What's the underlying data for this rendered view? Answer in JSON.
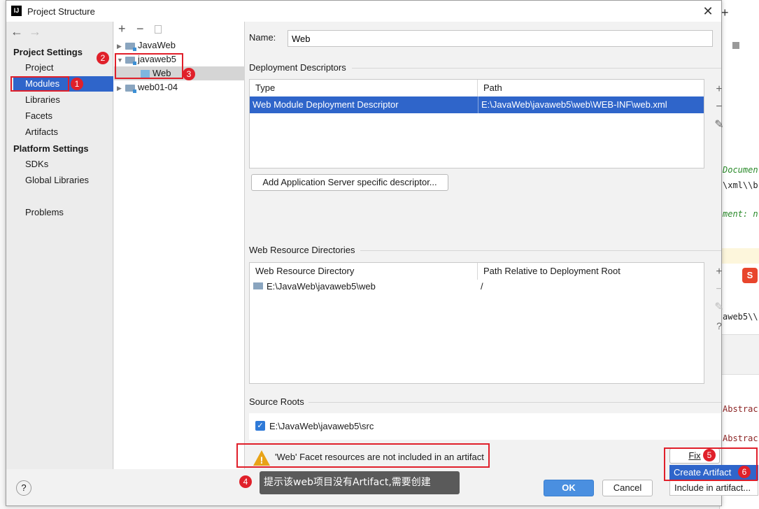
{
  "window": {
    "title": "Project Structure",
    "icon_text": "IJ"
  },
  "nav": {
    "project_settings_heading": "Project Settings",
    "project": "Project",
    "modules": "Modules",
    "libraries": "Libraries",
    "facets": "Facets",
    "artifacts": "Artifacts",
    "platform_settings_heading": "Platform Settings",
    "sdks": "SDKs",
    "global_libraries": "Global Libraries",
    "problems": "Problems"
  },
  "tree": {
    "items": [
      {
        "label": "JavaWeb"
      },
      {
        "label": "javaweb5"
      },
      {
        "label": "Web"
      },
      {
        "label": "web01-04"
      }
    ]
  },
  "name_field": {
    "label": "Name:",
    "value": "Web"
  },
  "deployment": {
    "heading": "Deployment Descriptors",
    "columns": [
      "Type",
      "Path"
    ],
    "rows": [
      {
        "type": "Web Module Deployment Descriptor",
        "path": "E:\\JavaWeb\\javaweb5\\web\\WEB-INF\\web.xml"
      }
    ],
    "add_button": "Add Application Server specific descriptor..."
  },
  "web_resources": {
    "heading": "Web Resource Directories",
    "columns": [
      "Web Resource Directory",
      "Path Relative to Deployment Root"
    ],
    "rows": [
      {
        "dir": "E:\\JavaWeb\\javaweb5\\web",
        "rel": "/"
      }
    ]
  },
  "source_roots": {
    "heading": "Source Roots",
    "item": "E:\\JavaWeb\\javaweb5\\src"
  },
  "warning": {
    "text": "'Web' Facet resources are not included in an artifact"
  },
  "fix_menu": {
    "fix": "Fix",
    "create_artifact": "Create Artifact",
    "include_in_artifact": "Include in artifact..."
  },
  "annotation_tooltip": "提示该web项目没有Artifact,需要创建",
  "buttons": {
    "ok": "OK",
    "cancel": "Cancel",
    "help": "?"
  },
  "badges": [
    "1",
    "2",
    "3",
    "4",
    "5",
    "6"
  ],
  "background_code": {
    "lines": [
      "Documen",
      "\\xml\\\\b",
      "ment: n",
      "aweb5\\\\",
      "Abstrac",
      "Abstrac"
    ]
  },
  "colors": {
    "selection": "#2f65ca",
    "annotation_red": "#e01f2a",
    "ok_button": "#4a8fe0"
  }
}
